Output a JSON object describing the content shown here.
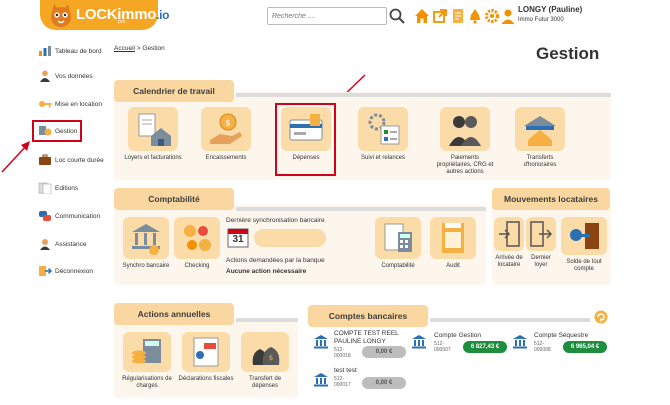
{
  "header": {
    "logo": "LOCKimmo",
    "logo_suffix": ".io",
    "logo_tagline": "pro",
    "search_placeholder": "Recherche ....",
    "user_name": "LONGY (Pauline)",
    "user_org": "Immo Futur 3000"
  },
  "sidebar": {
    "items": [
      {
        "label": "Tableau de bord",
        "icon": "dashboard-icon"
      },
      {
        "label": "Vos données",
        "icon": "person-icon"
      },
      {
        "label": "Mise en location",
        "icon": "key-icon"
      },
      {
        "label": "Gestion",
        "icon": "management-icon"
      },
      {
        "label": "Loc courte durée",
        "icon": "suitcase-icon"
      },
      {
        "label": "Editions",
        "icon": "documents-icon"
      },
      {
        "label": "Communication",
        "icon": "chat-icon"
      },
      {
        "label": "Assistance",
        "icon": "support-icon"
      },
      {
        "label": "Déconnexion",
        "icon": "logout-icon"
      }
    ]
  },
  "breadcrumb": {
    "home": "Accueil",
    "separator": ">",
    "current": "Gestion"
  },
  "page_title": "Gestion",
  "calendrier": {
    "title": "Calendrier de travail",
    "tiles": [
      {
        "label": "Loyers et facturations",
        "icon": "rent-invoice-icon"
      },
      {
        "label": "Encaissements",
        "icon": "payment-hand-icon"
      },
      {
        "label": "Dépenses",
        "icon": "expenses-icon"
      },
      {
        "label": "Suivi et relances",
        "icon": "followup-icon"
      },
      {
        "label": "Paiements propriétaires, CRG et autres actions",
        "icon": "owners-icon"
      },
      {
        "label": "Transferts d'honoraires",
        "icon": "fees-transfer-icon"
      }
    ]
  },
  "comptabilite": {
    "title": "Comptabilité",
    "tiles": [
      {
        "label": "Synchro bancaire",
        "icon": "bank-sync-icon"
      },
      {
        "label": "Checking",
        "icon": "checking-icon"
      },
      {
        "label": "Comptabilité",
        "icon": "accounting-icon"
      },
      {
        "label": "Audit",
        "icon": "audit-icon"
      }
    ],
    "sync_label": "Dernière synchronisation bancaire",
    "calendar_day": "31",
    "demand_label": "Actions demandées par la banque",
    "demand_value": "Aucune action nécessaire"
  },
  "mouvements": {
    "title": "Mouvements locataires",
    "tiles": [
      {
        "label": "Arrivée de locataire",
        "icon": "tenant-arrival-icon"
      },
      {
        "label": "Dernier loyer",
        "icon": "tenant-exit-icon"
      },
      {
        "label": "Solde de tout compte",
        "icon": "final-balance-icon"
      }
    ]
  },
  "actions_annuelles": {
    "title": "Actions annuelles",
    "tiles": [
      {
        "label": "Régularisations de charges",
        "icon": "charges-icon"
      },
      {
        "label": "Déclarations fiscales",
        "icon": "tax-icon"
      },
      {
        "label": "Transfert de dépenses",
        "icon": "money-bags-icon"
      }
    ]
  },
  "comptes": {
    "title": "Comptes bancaires",
    "accounts": [
      {
        "name": "COMPTE TEST REEL PAULINE LONGY",
        "number": "512-000018",
        "balance": "0,00 €",
        "status": "grey"
      },
      {
        "name": "Compte Gestion",
        "number": "512-000007",
        "balance": "6 827,43 €",
        "status": "green"
      },
      {
        "name": "Compte Séquestre",
        "number": "512-000008",
        "balance": "6 965,04 €",
        "status": "green"
      },
      {
        "name": "test test",
        "number": "512-000017",
        "balance": "0,00 €",
        "status": "grey"
      }
    ]
  },
  "colors": {
    "accent": "#f5a623",
    "section": "#fad7a0",
    "highlight": "#d0021b",
    "positive": "#1e8e3e"
  }
}
